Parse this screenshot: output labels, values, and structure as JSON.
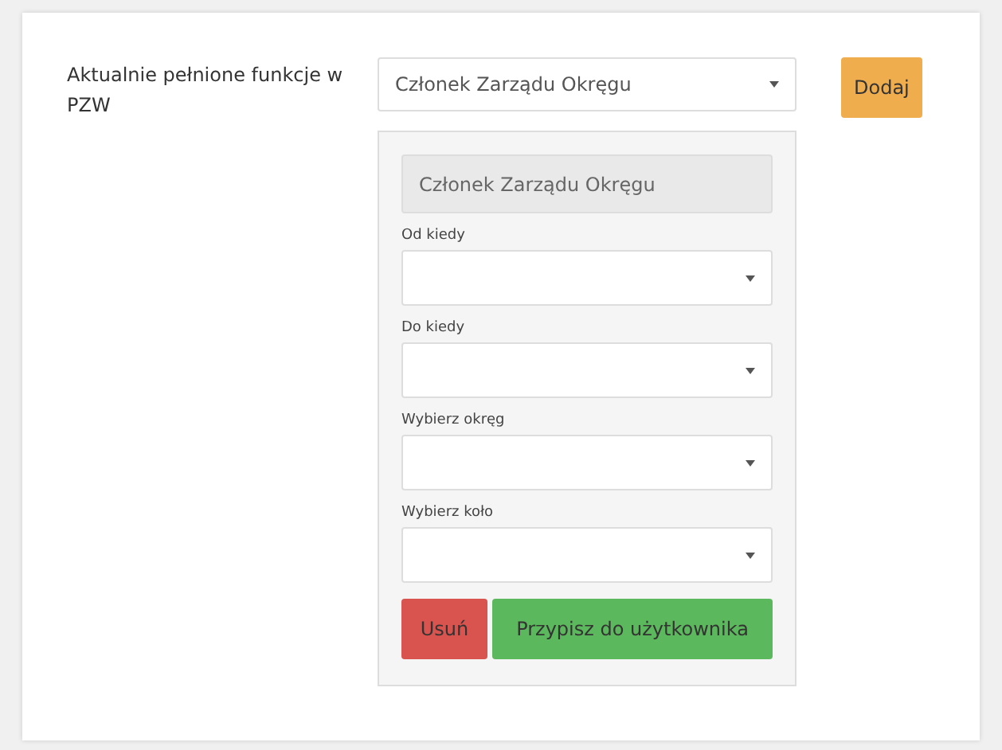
{
  "form_label": "Aktualnie pełnione funkcje w PZW",
  "function_select": {
    "value": "Członek Zarządu Okręgu"
  },
  "add_button": {
    "label": "Dodaj"
  },
  "panel": {
    "function_field": {
      "value": "Członek Zarządu Okręgu",
      "disabled": true
    },
    "fields": [
      {
        "label": "Od kiedy"
      },
      {
        "label": "Do kiedy"
      },
      {
        "label": "Wybierz okręg"
      },
      {
        "label": "Wybierz koło"
      }
    ],
    "buttons": [
      {
        "label": "Usuń",
        "kind": "danger"
      },
      {
        "label": "Przypisz do użytkownika",
        "kind": "success"
      }
    ]
  }
}
